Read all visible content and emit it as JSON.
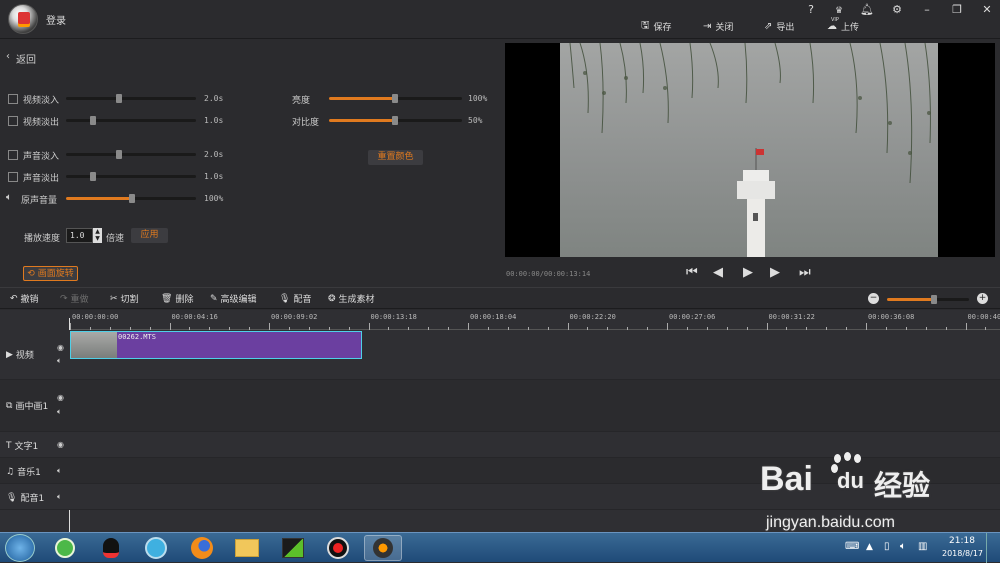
{
  "titlebar": {
    "title": "登录",
    "vip_label": "VIP",
    "actions": {
      "save": "保存",
      "close": "关闭",
      "export": "导出",
      "upload": "上传"
    }
  },
  "left_panel": {
    "back": "返回",
    "video_fade_in": {
      "label": "视频淡入",
      "value": "2.0s",
      "level": 0.4
    },
    "video_fade_out": {
      "label": "视频淡出",
      "value": "1.0s",
      "level": 0.2
    },
    "audio_fade_in": {
      "label": "声音淡入",
      "value": "2.0s",
      "level": 0.4
    },
    "audio_fade_out": {
      "label": "声音淡出",
      "value": "1.0s",
      "level": 0.2
    },
    "original_volume": {
      "label": "原声音量",
      "value": "100%",
      "level": 0.5
    },
    "brightness": {
      "label": "亮度",
      "value": "100%",
      "level": 0.5
    },
    "contrast": {
      "label": "对比度",
      "value": "50%",
      "level": 0.5
    },
    "reset_color": "重置颜色",
    "speed_label": "播放速度",
    "speed_value": "1.0",
    "speed_unit": "倍速",
    "apply": "应用",
    "rotate": "画面旋转"
  },
  "preview": {
    "timecode": "00:00:00/00:00:13:14"
  },
  "toolbar": {
    "undo": "撤销",
    "redo": "重做",
    "cut": "切割",
    "delete": "删除",
    "advanced_edit": "高级编辑",
    "dub": "配音",
    "generate": "生成素材",
    "zoom_level": 0.7
  },
  "ruler": [
    "00:00:00:00",
    "00:00:04:16",
    "00:00:09:02",
    "00:00:13:18",
    "00:00:18:04",
    "00:00:22:20",
    "00:00:27:06",
    "00:00:31:22",
    "00:00:36:08",
    "00:00:40"
  ],
  "tracks": {
    "video": "视频",
    "pip": "画中画1",
    "text": "文字1",
    "music": "音乐1",
    "dub": "配音1"
  },
  "clip": {
    "name": "00262.MTS"
  },
  "taskbar": {
    "time": "21:18",
    "date": "2018/8/17"
  },
  "watermark": {
    "brand": "Bai",
    "brand2": "du",
    "cn": "经验",
    "url": "jingyan.baidu.com"
  },
  "colors": {
    "accent": "#e07a1f",
    "clip": "#6b3fa0",
    "clip_border": "#4fd0e8"
  }
}
